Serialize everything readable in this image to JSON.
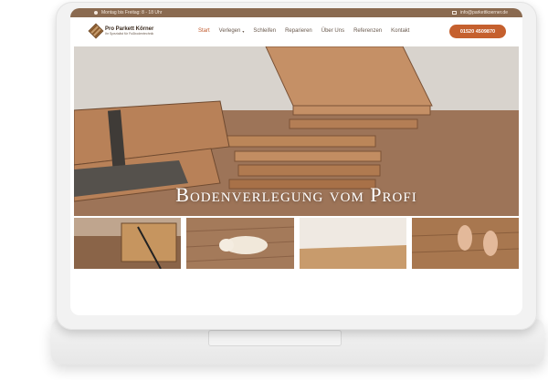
{
  "topbar": {
    "hours": "Montag bis Freitag: 8 - 18 Uhr",
    "email": "info@parkettkoerner.de"
  },
  "header": {
    "company_name": "Pro Parkett Körner",
    "company_tagline": "Ihr Spezialist für Fußbodentechnik",
    "phone": "01520 4509870"
  },
  "nav": {
    "items": [
      "Start",
      "Verlegen",
      "Schleifen",
      "Reparieren",
      "Über Uns",
      "Referenzen",
      "Kontakt"
    ],
    "active": "Start"
  },
  "hero": {
    "title": "Bodenverlegung vom Profi"
  },
  "colors": {
    "accent": "#c5602e",
    "topbar": "#8a6a50",
    "wood": "#b07a50"
  },
  "icons": [
    "clock-icon",
    "mail-icon",
    "chevron-down-icon",
    "logo-parquet-icon"
  ]
}
